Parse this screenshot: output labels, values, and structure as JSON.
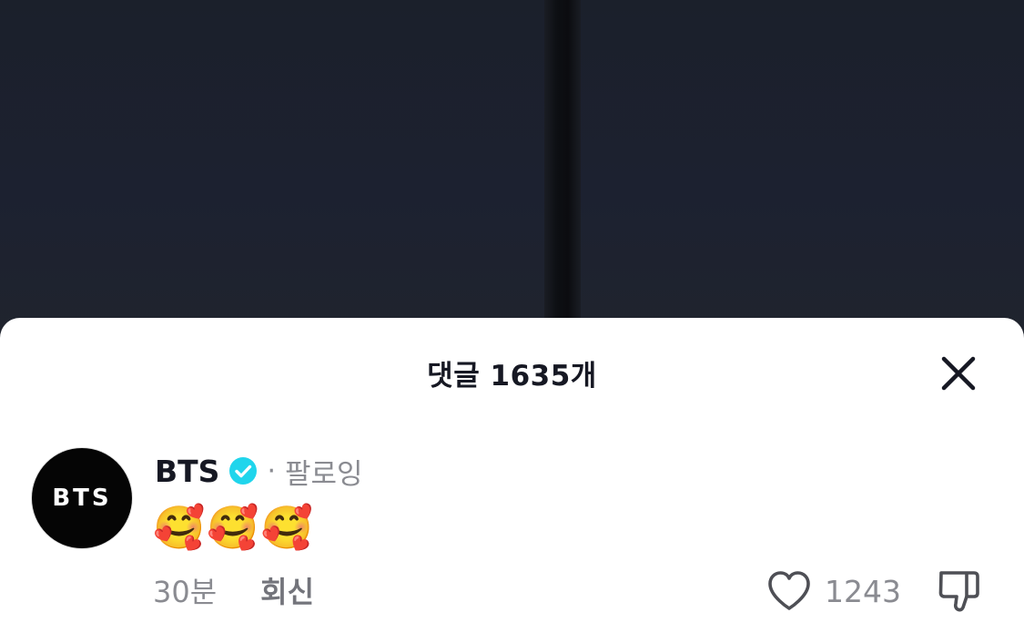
{
  "comments_panel": {
    "title": "댓글 1635개",
    "close_icon": "close-icon"
  },
  "comment": {
    "username": "BTS",
    "avatar_text": "BTS",
    "verified_icon": "verified-badge-icon",
    "separator": "·",
    "follow_status": "팔로잉",
    "text": "🥰🥰🥰",
    "time": "30분",
    "reply_label": "회신",
    "like_icon": "heart-outline-icon",
    "like_count": "1243",
    "dislike_icon": "thumbs-down-icon"
  },
  "colors": {
    "verified": "#20D5EC",
    "text_primary": "#161823",
    "text_secondary": "#8A8B91",
    "background_video": "#1B202B"
  }
}
